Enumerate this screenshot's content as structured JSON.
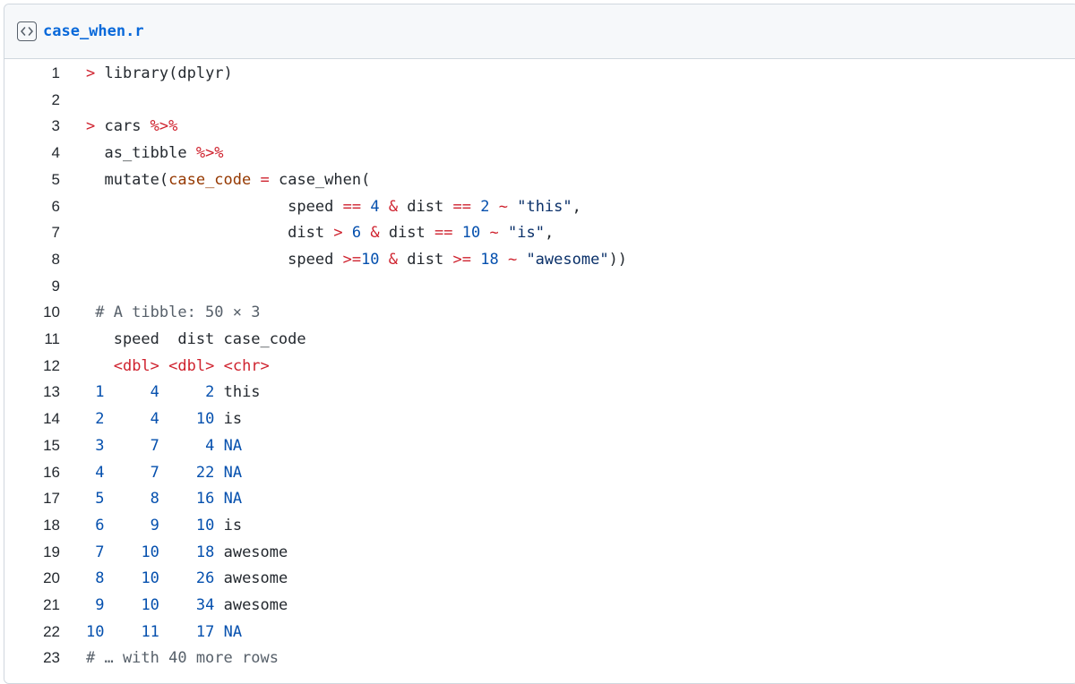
{
  "file": {
    "name": "case_when.r",
    "icon": "code-file-icon"
  },
  "lines": [
    {
      "n": "1",
      "t": [
        {
          "c": "red",
          "s": "> "
        },
        {
          "c": "",
          "s": "library(dplyr)"
        }
      ]
    },
    {
      "n": "2",
      "t": []
    },
    {
      "n": "3",
      "t": [
        {
          "c": "red",
          "s": "> "
        },
        {
          "c": "",
          "s": "cars "
        },
        {
          "c": "red",
          "s": "%>%"
        }
      ]
    },
    {
      "n": "4",
      "t": [
        {
          "c": "",
          "s": "  as_tibble "
        },
        {
          "c": "red",
          "s": "%>%"
        }
      ]
    },
    {
      "n": "5",
      "t": [
        {
          "c": "",
          "s": "  mutate("
        },
        {
          "c": "brown",
          "s": "case_code"
        },
        {
          "c": "",
          "s": " "
        },
        {
          "c": "red",
          "s": "="
        },
        {
          "c": "",
          "s": " case_when("
        }
      ]
    },
    {
      "n": "6",
      "t": [
        {
          "c": "",
          "s": "                      speed "
        },
        {
          "c": "red",
          "s": "=="
        },
        {
          "c": "",
          "s": " "
        },
        {
          "c": "blue",
          "s": "4"
        },
        {
          "c": "",
          "s": " "
        },
        {
          "c": "red",
          "s": "&"
        },
        {
          "c": "",
          "s": " dist "
        },
        {
          "c": "red",
          "s": "=="
        },
        {
          "c": "",
          "s": " "
        },
        {
          "c": "blue",
          "s": "2"
        },
        {
          "c": "",
          "s": " "
        },
        {
          "c": "red",
          "s": "~"
        },
        {
          "c": "",
          "s": " "
        },
        {
          "c": "str",
          "s": "\"this\""
        },
        {
          "c": "",
          "s": ","
        }
      ]
    },
    {
      "n": "7",
      "t": [
        {
          "c": "",
          "s": "                      dist "
        },
        {
          "c": "red",
          "s": ">"
        },
        {
          "c": "",
          "s": " "
        },
        {
          "c": "blue",
          "s": "6"
        },
        {
          "c": "",
          "s": " "
        },
        {
          "c": "red",
          "s": "&"
        },
        {
          "c": "",
          "s": " dist "
        },
        {
          "c": "red",
          "s": "=="
        },
        {
          "c": "",
          "s": " "
        },
        {
          "c": "blue",
          "s": "10"
        },
        {
          "c": "",
          "s": " "
        },
        {
          "c": "red",
          "s": "~"
        },
        {
          "c": "",
          "s": " "
        },
        {
          "c": "str",
          "s": "\"is\""
        },
        {
          "c": "",
          "s": ","
        }
      ]
    },
    {
      "n": "8",
      "t": [
        {
          "c": "",
          "s": "                      speed "
        },
        {
          "c": "red",
          "s": ">="
        },
        {
          "c": "blue",
          "s": "10"
        },
        {
          "c": "",
          "s": " "
        },
        {
          "c": "red",
          "s": "&"
        },
        {
          "c": "",
          "s": " dist "
        },
        {
          "c": "red",
          "s": ">="
        },
        {
          "c": "",
          "s": " "
        },
        {
          "c": "blue",
          "s": "18"
        },
        {
          "c": "",
          "s": " "
        },
        {
          "c": "red",
          "s": "~"
        },
        {
          "c": "",
          "s": " "
        },
        {
          "c": "str",
          "s": "\"awesome\""
        },
        {
          "c": "",
          "s": "))"
        }
      ]
    },
    {
      "n": "9",
      "t": []
    },
    {
      "n": "10",
      "t": [
        {
          "c": "gray",
          "s": " # A tibble: 50 × 3"
        }
      ]
    },
    {
      "n": "11",
      "t": [
        {
          "c": "",
          "s": "   speed  dist case_code"
        }
      ]
    },
    {
      "n": "12",
      "t": [
        {
          "c": "",
          "s": "   "
        },
        {
          "c": "red",
          "s": "<dbl>"
        },
        {
          "c": "",
          "s": " "
        },
        {
          "c": "red",
          "s": "<dbl>"
        },
        {
          "c": "",
          "s": " "
        },
        {
          "c": "red",
          "s": "<chr>"
        }
      ]
    },
    {
      "n": "13",
      "t": [
        {
          "c": "blue",
          "s": " 1"
        },
        {
          "c": "",
          "s": "     "
        },
        {
          "c": "blue",
          "s": "4"
        },
        {
          "c": "",
          "s": "     "
        },
        {
          "c": "blue",
          "s": "2"
        },
        {
          "c": "",
          "s": " this"
        }
      ]
    },
    {
      "n": "14",
      "t": [
        {
          "c": "blue",
          "s": " 2"
        },
        {
          "c": "",
          "s": "     "
        },
        {
          "c": "blue",
          "s": "4"
        },
        {
          "c": "",
          "s": "    "
        },
        {
          "c": "blue",
          "s": "10"
        },
        {
          "c": "",
          "s": " is"
        }
      ]
    },
    {
      "n": "15",
      "t": [
        {
          "c": "blue",
          "s": " 3"
        },
        {
          "c": "",
          "s": "     "
        },
        {
          "c": "blue",
          "s": "7"
        },
        {
          "c": "",
          "s": "     "
        },
        {
          "c": "blue",
          "s": "4"
        },
        {
          "c": "",
          "s": " "
        },
        {
          "c": "blue",
          "s": "NA"
        }
      ]
    },
    {
      "n": "16",
      "t": [
        {
          "c": "blue",
          "s": " 4"
        },
        {
          "c": "",
          "s": "     "
        },
        {
          "c": "blue",
          "s": "7"
        },
        {
          "c": "",
          "s": "    "
        },
        {
          "c": "blue",
          "s": "22"
        },
        {
          "c": "",
          "s": " "
        },
        {
          "c": "blue",
          "s": "NA"
        }
      ]
    },
    {
      "n": "17",
      "t": [
        {
          "c": "blue",
          "s": " 5"
        },
        {
          "c": "",
          "s": "     "
        },
        {
          "c": "blue",
          "s": "8"
        },
        {
          "c": "",
          "s": "    "
        },
        {
          "c": "blue",
          "s": "16"
        },
        {
          "c": "",
          "s": " "
        },
        {
          "c": "blue",
          "s": "NA"
        }
      ]
    },
    {
      "n": "18",
      "t": [
        {
          "c": "blue",
          "s": " 6"
        },
        {
          "c": "",
          "s": "     "
        },
        {
          "c": "blue",
          "s": "9"
        },
        {
          "c": "",
          "s": "    "
        },
        {
          "c": "blue",
          "s": "10"
        },
        {
          "c": "",
          "s": " is"
        }
      ]
    },
    {
      "n": "19",
      "t": [
        {
          "c": "blue",
          "s": " 7"
        },
        {
          "c": "",
          "s": "    "
        },
        {
          "c": "blue",
          "s": "10"
        },
        {
          "c": "",
          "s": "    "
        },
        {
          "c": "blue",
          "s": "18"
        },
        {
          "c": "",
          "s": " awesome"
        }
      ]
    },
    {
      "n": "20",
      "t": [
        {
          "c": "blue",
          "s": " 8"
        },
        {
          "c": "",
          "s": "    "
        },
        {
          "c": "blue",
          "s": "10"
        },
        {
          "c": "",
          "s": "    "
        },
        {
          "c": "blue",
          "s": "26"
        },
        {
          "c": "",
          "s": " awesome"
        }
      ]
    },
    {
      "n": "21",
      "t": [
        {
          "c": "blue",
          "s": " 9"
        },
        {
          "c": "",
          "s": "    "
        },
        {
          "c": "blue",
          "s": "10"
        },
        {
          "c": "",
          "s": "    "
        },
        {
          "c": "blue",
          "s": "34"
        },
        {
          "c": "",
          "s": " awesome"
        }
      ]
    },
    {
      "n": "22",
      "t": [
        {
          "c": "blue",
          "s": "10"
        },
        {
          "c": "",
          "s": "    "
        },
        {
          "c": "blue",
          "s": "11"
        },
        {
          "c": "",
          "s": "    "
        },
        {
          "c": "blue",
          "s": "17"
        },
        {
          "c": "",
          "s": " "
        },
        {
          "c": "blue",
          "s": "NA"
        }
      ]
    },
    {
      "n": "23",
      "t": [
        {
          "c": "gray",
          "s": "# … with 40 more rows"
        }
      ]
    }
  ]
}
